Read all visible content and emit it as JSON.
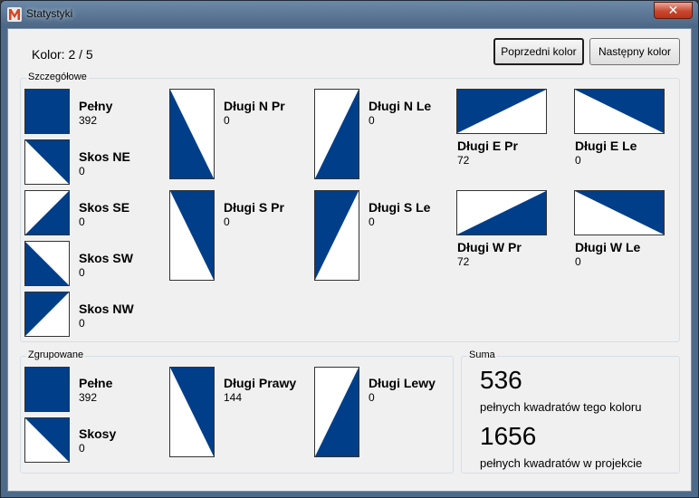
{
  "window": {
    "title": "Statystyki",
    "close_label": "✕",
    "app_icon": "m-logo-icon"
  },
  "header": {
    "color_label": "Kolor: 2 / 5",
    "prev_button": "Poprzedni kolor",
    "next_button": "Następny kolor"
  },
  "colors": {
    "fill": "#003e8a",
    "accent_close": "#c8472f"
  },
  "details": {
    "title": "Szczegółowe",
    "items": {
      "pelny": {
        "name": "Pełny",
        "value": "392",
        "icon": "full-square-icon"
      },
      "skos_ne": {
        "name": "Skos NE",
        "value": "0",
        "icon": "diagonal-ne-icon"
      },
      "skos_se": {
        "name": "Skos SE",
        "value": "0",
        "icon": "diagonal-se-icon"
      },
      "skos_sw": {
        "name": "Skos SW",
        "value": "0",
        "icon": "diagonal-sw-icon"
      },
      "skos_nw": {
        "name": "Skos NW",
        "value": "0",
        "icon": "diagonal-nw-icon"
      },
      "dlugi_n_pr": {
        "name": "Długi N Pr",
        "value": "0",
        "icon": "long-n-right-icon"
      },
      "dlugi_s_pr": {
        "name": "Długi S Pr",
        "value": "0",
        "icon": "long-s-right-icon"
      },
      "dlugi_n_le": {
        "name": "Długi N Le",
        "value": "0",
        "icon": "long-n-left-icon"
      },
      "dlugi_s_le": {
        "name": "Długi S Le",
        "value": "0",
        "icon": "long-s-left-icon"
      },
      "dlugi_e_pr": {
        "name": "Długi E Pr",
        "value": "72",
        "icon": "long-e-right-icon"
      },
      "dlugi_w_pr": {
        "name": "Długi W Pr",
        "value": "72",
        "icon": "long-w-right-icon"
      },
      "dlugi_e_le": {
        "name": "Długi E Le",
        "value": "0",
        "icon": "long-e-left-icon"
      },
      "dlugi_w_le": {
        "name": "Długi W Le",
        "value": "0",
        "icon": "long-w-left-icon"
      }
    }
  },
  "grouped": {
    "title": "Zgrupowane",
    "items": {
      "pelne": {
        "name": "Pełne",
        "value": "392",
        "icon": "full-square-icon"
      },
      "skosy": {
        "name": "Skosy",
        "value": "0",
        "icon": "diagonal-icon"
      },
      "dlugi_prawy": {
        "name": "Długi Prawy",
        "value": "144",
        "icon": "long-right-icon"
      },
      "dlugi_lewy": {
        "name": "Długi Lewy",
        "value": "0",
        "icon": "long-left-icon"
      }
    }
  },
  "summary": {
    "title": "Suma",
    "color_count": "536",
    "color_text": "pełnych kwadratów tego koloru",
    "project_count": "1656",
    "project_text": "pełnych kwadratów w projekcie"
  }
}
